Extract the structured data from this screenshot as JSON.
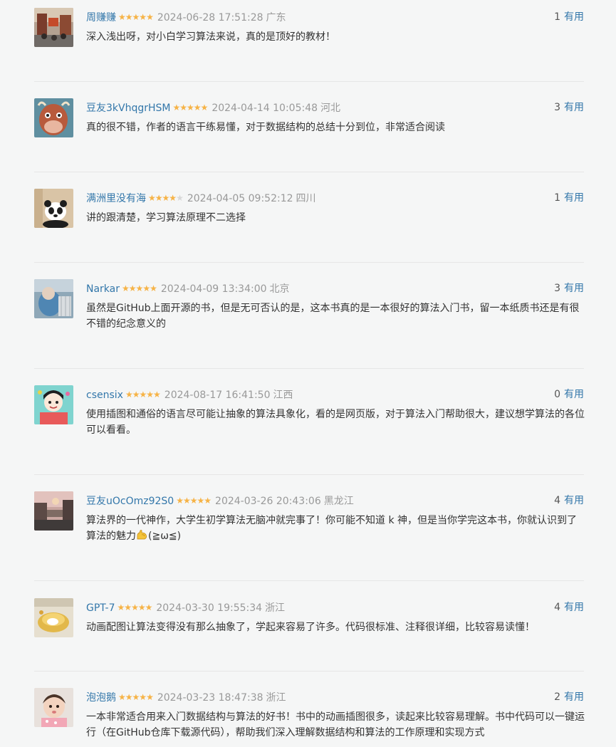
{
  "colors": {
    "background": "#f5f6f6",
    "username_link": "#3377aa",
    "star_filled": "#f6b346",
    "star_empty": "#d8d8d8",
    "muted_text": "#999999",
    "separator": "#e6e6e6"
  },
  "useful_label": "有用",
  "reviews": [
    {
      "user": "周赚赚",
      "rating": 5,
      "time": "2024-06-28 17:51:28",
      "location": "广东",
      "useful_count": "1",
      "content": "深入浅出呀，对小白学习算法来说，真的是顶好的教材！",
      "avatar_icon": "street-photo-avatar"
    },
    {
      "user": "豆友3kVhqgrHSM",
      "rating": 5,
      "time": "2024-04-14 10:05:48",
      "location": "河北",
      "useful_count": "3",
      "content": "真的很不错，作者的语言干练易懂，对于数据结构的总结十分到位，非常适合阅读",
      "avatar_icon": "cartoon-cow-avatar"
    },
    {
      "user": "满洲里没有海",
      "rating": 4,
      "time": "2024-04-05 09:52:12",
      "location": "四川",
      "useful_count": "1",
      "content": "讲的跟清楚，学习算法原理不二选择",
      "avatar_icon": "panda-avatar"
    },
    {
      "user": "Narkar",
      "rating": 5,
      "time": "2024-04-09 13:34:00",
      "location": "北京",
      "useful_count": "3",
      "content": "虽然是GitHub上面开源的书，但是无可否认的是，这本书真的是一本很好的算法入门书，留一本纸质书还是有很不错的纪念意义的",
      "avatar_icon": "blue-photo-avatar"
    },
    {
      "user": "csensix",
      "rating": 5,
      "time": "2024-08-17 16:41:50",
      "location": "江西",
      "useful_count": "0",
      "content": "使用插图和通俗的语言尽可能让抽象的算法具象化，看的是网页版，对于算法入门帮助很大，建议想学算法的各位可以看看。",
      "avatar_icon": "cartoon-girl-avatar"
    },
    {
      "user": "豆友uOcOmz92S0",
      "rating": 5,
      "time": "2024-03-26 20:43:06",
      "location": "黑龙江",
      "useful_count": "4",
      "content_parts": [
        "算法界的一代神作，大学生初学算法无脑冲就完事了！你可能不知道 k 神，但是当你学完这本书，你就认识到了算法的魅力",
        "(≧ω≦)"
      ],
      "emoji_icon": "flexed-biceps-icon",
      "avatar_icon": "sunset-street-avatar"
    },
    {
      "user": "GPT-7",
      "rating": 5,
      "time": "2024-03-30 19:55:34",
      "location": "浙江",
      "useful_count": "4",
      "content": "动画配图让算法变得没有那么抽象了，学起来容易了许多。代码很标准、注释很详细，比较容易读懂！",
      "avatar_icon": "gold-object-avatar"
    },
    {
      "user": "泡泡鹅",
      "rating": 5,
      "time": "2024-03-23 18:47:38",
      "location": "浙江",
      "useful_count": "2",
      "content": "一本非常适合用来入门数据结构与算法的好书！书中的动画插图很多，读起来比较容易理解。书中代码可以一键运行（在GitHub仓库下载源代码），帮助我们深入理解数据结构和算法的工作原理和实现方式",
      "avatar_icon": "baby-photo-avatar"
    }
  ]
}
